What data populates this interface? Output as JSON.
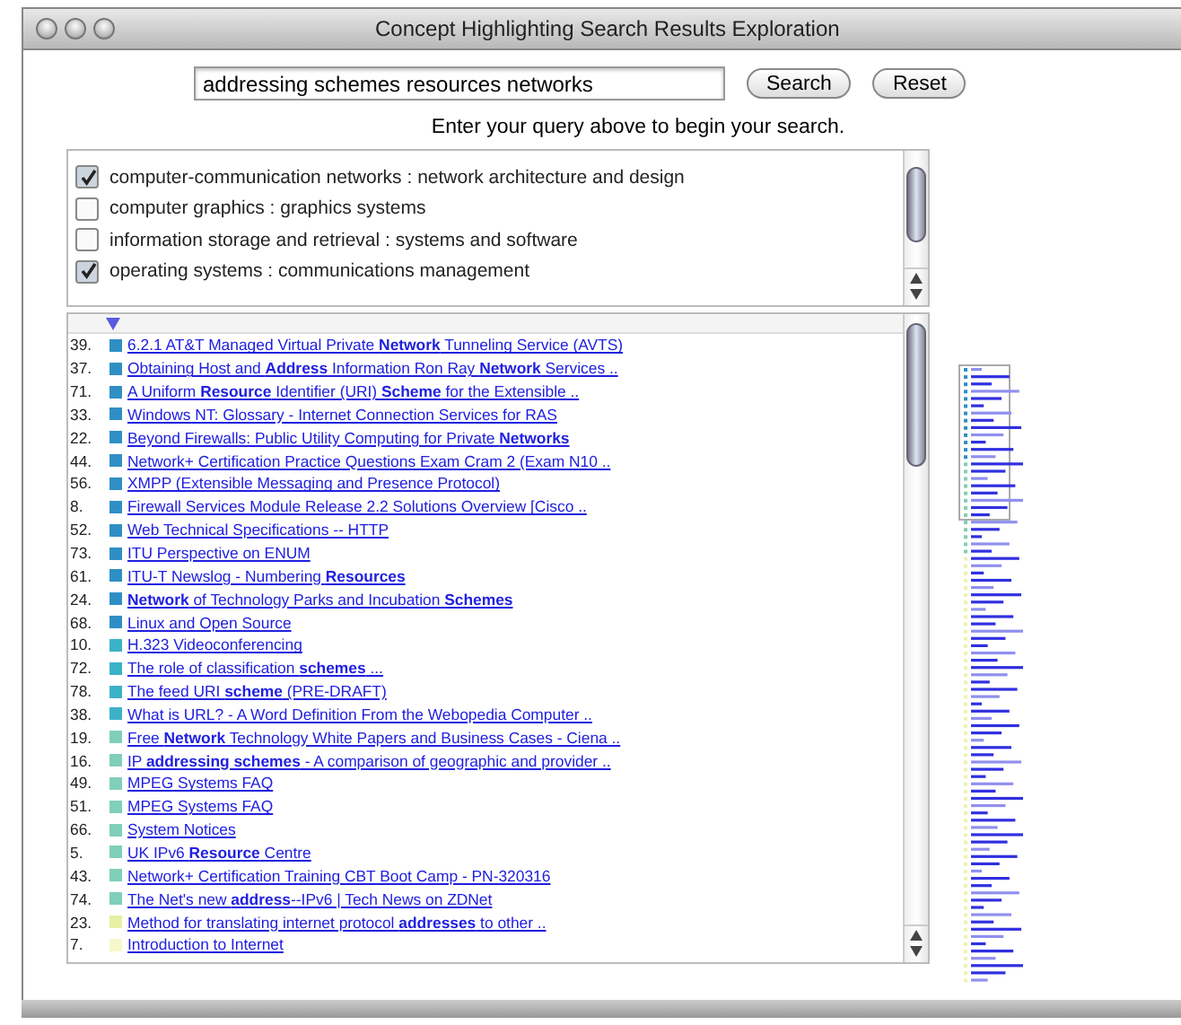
{
  "window": {
    "title": "Concept Highlighting Search Results Exploration"
  },
  "search": {
    "value": "addressing schemes resources networks",
    "buttons": [
      "Search",
      "Reset"
    ],
    "hint": "Enter your query above to begin your search."
  },
  "concepts": [
    {
      "label": "computer-communication networks : network architecture and design",
      "checked": true
    },
    {
      "label": "computer graphics : graphics systems",
      "checked": false
    },
    {
      "label": "information storage and retrieval : systems and software",
      "checked": false
    },
    {
      "label": "operating systems : communications management",
      "checked": true
    }
  ],
  "results": [
    {
      "rank": "39.",
      "color": "#2f8fc4",
      "title": "6.2.1 AT&T Managed Virtual Private **Network** Tunneling Service (AVTS)"
    },
    {
      "rank": "37.",
      "color": "#2f8fc4",
      "title": "Obtaining Host and **Address** Information Ron Ray **Network** Services .."
    },
    {
      "rank": "71.",
      "color": "#2f8fc4",
      "title": "A Uniform **Resource** Identifier (URI) **Scheme** for the Extensible .."
    },
    {
      "rank": "33.",
      "color": "#2f8fc4",
      "title": "Windows NT: Glossary - Internet Connection Services for RAS"
    },
    {
      "rank": "22.",
      "color": "#2f8fc4",
      "title": "Beyond Firewalls: Public Utility Computing for Private **Networks**"
    },
    {
      "rank": "44.",
      "color": "#2f8fc4",
      "title": "Network+ Certification Practice Questions Exam Cram 2 (Exam N10 .."
    },
    {
      "rank": "56.",
      "color": "#2f8fc4",
      "title": "XMPP (Extensible Messaging and Presence Protocol)"
    },
    {
      "rank": "8.",
      "color": "#2f8fc4",
      "title": "Firewall Services Module Release 2.2 Solutions Overview [Cisco .."
    },
    {
      "rank": "52.",
      "color": "#2f8fc4",
      "title": "Web Technical Specifications -- HTTP"
    },
    {
      "rank": "73.",
      "color": "#2f8fc4",
      "title": "ITU Perspective on ENUM"
    },
    {
      "rank": "61.",
      "color": "#2f8fc4",
      "title": "ITU-T Newslog - Numbering **Resources**"
    },
    {
      "rank": "24.",
      "color": "#2f8fc4",
      "title": "**Network** of Technology Parks and Incubation **Schemes**"
    },
    {
      "rank": "68.",
      "color": "#2f8fc4",
      "title": "Linux and Open Source"
    },
    {
      "rank": "10.",
      "color": "#3cb2c8",
      "title": "H.323 Videoconferencing"
    },
    {
      "rank": "72.",
      "color": "#3cb2c8",
      "title": "The role of classification **schemes** ..."
    },
    {
      "rank": "78.",
      "color": "#3cb2c8",
      "title": "The feed URI **scheme** (PRE-DRAFT)"
    },
    {
      "rank": "38.",
      "color": "#3cb2c8",
      "title": "What is URL? - A Word Definition From the Webopedia Computer .."
    },
    {
      "rank": "19.",
      "color": "#80cfb8",
      "title": "Free **Network** Technology White Papers and Business Cases - Ciena .."
    },
    {
      "rank": "16.",
      "color": "#80cfb8",
      "title": "IP **addressing schemes** - A comparison of geographic and provider .."
    },
    {
      "rank": "49.",
      "color": "#80cfb8",
      "title": "MPEG Systems FAQ"
    },
    {
      "rank": "51.",
      "color": "#80cfb8",
      "title": "MPEG Systems FAQ"
    },
    {
      "rank": "66.",
      "color": "#80cfb8",
      "title": "System Notices"
    },
    {
      "rank": "5.",
      "color": "#80cfb8",
      "title": "UK IPv6 **Resource** Centre"
    },
    {
      "rank": "43.",
      "color": "#80cfb8",
      "title": "Network+ Certification Training CBT Boot Camp - PN-320316"
    },
    {
      "rank": "74.",
      "color": "#80cfb8",
      "title": "The Net's new **address**--IPv6 | Tech News on ZDNet"
    },
    {
      "rank": "23.",
      "color": "#e6efa2",
      "title": "Method for translating internet protocol **addresses** to other .."
    },
    {
      "rank": "7.",
      "color": "#f6f8cc",
      "title": "Introduction to Internet"
    }
  ]
}
